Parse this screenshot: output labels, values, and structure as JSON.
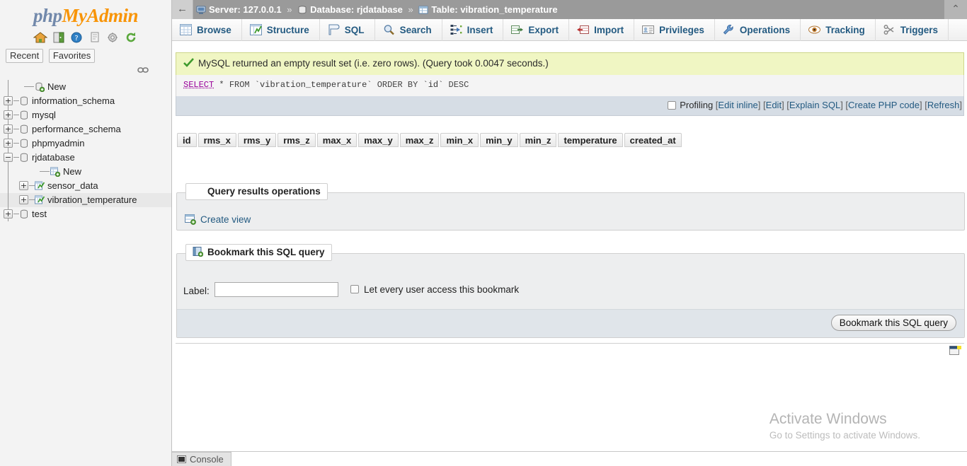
{
  "app": {
    "logo_php": "php",
    "logo_my": "My",
    "logo_admin": "Admin"
  },
  "sidebar": {
    "header_icons": [
      "home-icon",
      "logout-icon",
      "help-icon",
      "docs-icon",
      "settings-icon",
      "reload-icon"
    ],
    "tabs": [
      {
        "label": "Recent",
        "name": "recent-tab"
      },
      {
        "label": "Favorites",
        "name": "favorites-tab"
      }
    ],
    "chain_icon": "chain-link-icon",
    "tree": [
      {
        "label": "New",
        "depth": 1,
        "toggle": "",
        "icon": "new-db-icon",
        "selected": false
      },
      {
        "label": "information_schema",
        "depth": 0,
        "toggle": "+",
        "icon": "database-icon",
        "selected": false
      },
      {
        "label": "mysql",
        "depth": 0,
        "toggle": "+",
        "icon": "database-icon",
        "selected": false
      },
      {
        "label": "performance_schema",
        "depth": 0,
        "toggle": "+",
        "icon": "database-icon",
        "selected": false
      },
      {
        "label": "phpmyadmin",
        "depth": 0,
        "toggle": "+",
        "icon": "database-icon",
        "selected": false
      },
      {
        "label": "rjdatabase",
        "depth": 0,
        "toggle": "−",
        "icon": "database-icon",
        "selected": false
      },
      {
        "label": "New",
        "depth": 2,
        "toggle": "",
        "icon": "new-table-icon",
        "selected": false
      },
      {
        "label": "sensor_data",
        "depth": 1,
        "toggle": "+",
        "icon": "table-icon",
        "selected": false
      },
      {
        "label": "vibration_temperature",
        "depth": 1,
        "toggle": "+",
        "icon": "table-icon",
        "selected": true
      },
      {
        "label": "test",
        "depth": 0,
        "toggle": "+",
        "icon": "database-icon",
        "selected": false
      }
    ]
  },
  "breadcrumb": {
    "back_glyph": "←",
    "server_icon": "server-icon",
    "server": "Server: 127.0.0.1",
    "sep": "»",
    "database_icon": "database-icon",
    "database": "Database: rjdatabase",
    "table_icon": "table-icon",
    "table": "Table: vibration_temperature",
    "collapse_glyph": "⌃"
  },
  "nav_tabs": [
    {
      "label": "Browse",
      "icon": "browse-icon"
    },
    {
      "label": "Structure",
      "icon": "structure-icon"
    },
    {
      "label": "SQL",
      "icon": "sql-icon"
    },
    {
      "label": "Search",
      "icon": "search-icon"
    },
    {
      "label": "Insert",
      "icon": "insert-icon"
    },
    {
      "label": "Export",
      "icon": "export-icon"
    },
    {
      "label": "Import",
      "icon": "import-icon"
    },
    {
      "label": "Privileges",
      "icon": "privileges-icon"
    },
    {
      "label": "Operations",
      "icon": "operations-icon"
    },
    {
      "label": "Tracking",
      "icon": "tracking-icon"
    },
    {
      "label": "Triggers",
      "icon": "triggers-icon"
    }
  ],
  "result": {
    "success_icon": "check-icon",
    "success_message": "MySQL returned an empty result set (i.e. zero rows). (Query took 0.0047 seconds.)",
    "query": {
      "kw_select": "SELECT",
      "star": "*",
      "kw_from": "FROM",
      "table": "`vibration_temperature`",
      "kw_order": "ORDER BY",
      "column": "`id`",
      "kw_desc": "DESC"
    },
    "actions": {
      "profiling_label": "Profiling",
      "links": [
        "Edit inline",
        "Edit",
        "Explain SQL",
        "Create PHP code",
        "Refresh"
      ]
    },
    "columns": [
      "id",
      "rms_x",
      "rms_y",
      "rms_z",
      "max_x",
      "max_y",
      "max_z",
      "min_x",
      "min_y",
      "min_z",
      "temperature",
      "created_at"
    ]
  },
  "query_ops": {
    "legend": "Query results operations",
    "legend_icon": "view-icon",
    "create_view_label": "Create view",
    "create_view_icon": "create-view-icon"
  },
  "bookmark": {
    "legend": "Bookmark this SQL query",
    "legend_icon": "bookmark-icon",
    "label_text": "Label:",
    "label_value": "",
    "label_placeholder": "",
    "checkbox_label": "Let every user access this bookmark",
    "checkbox_checked": false,
    "submit_label": "Bookmark this SQL query"
  },
  "panel_right_icon": "window-panel-icon",
  "watermark": {
    "title": "Activate Windows",
    "subtitle": "Go to Settings to activate Windows."
  },
  "console": {
    "label": "Console",
    "icon": "console-icon"
  },
  "colors": {
    "accent_link": "#235a81",
    "success_bg": "#f0f6c3",
    "action_bar_bg": "#d6dde5",
    "brand_orange": "#f89406",
    "brand_blue": "#7289ab"
  }
}
